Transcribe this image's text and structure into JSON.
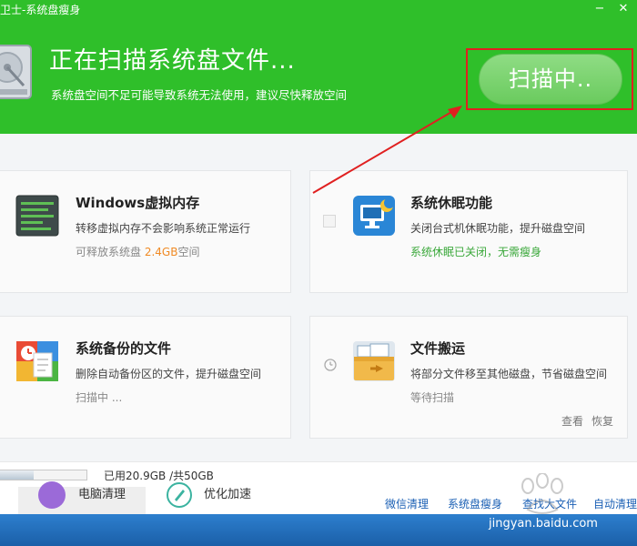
{
  "window": {
    "title": "卫士-系统盘瘦身",
    "minimize_glyph": "−",
    "close_glyph": "✕"
  },
  "header": {
    "heading": "正在扫描系统盘文件...",
    "subtitle": "系统盘空间不足可能导致系统无法使用，建议尽快释放空间",
    "scan_button": "扫描中.."
  },
  "cards": [
    {
      "title": "Windows虚拟内存",
      "desc": "转移虚拟内存不会影响系统正常运行",
      "status_prefix": "可释放系统盘 ",
      "status_value": "2.4GB",
      "status_suffix": "空间"
    },
    {
      "title": "系统休眠功能",
      "desc": "关闭台式机休眠功能，提升磁盘空间",
      "status": "系统休眠已关闭，无需瘦身"
    },
    {
      "title": "系统备份的文件",
      "desc": "删除自动备份区的文件，提升磁盘空间",
      "status": "扫描中 ..."
    },
    {
      "title": "文件搬运",
      "desc": "将部分文件移至其他磁盘，节省磁盘空间",
      "status": "等待扫描",
      "link_view": "查看",
      "link_restore": "恢复"
    }
  ],
  "usage": {
    "text": "已用20.9GB /共50GB",
    "used_fraction": 0.418
  },
  "bottom": {
    "tabs": [
      {
        "label": "电脑清理"
      },
      {
        "label": "优化加速"
      }
    ],
    "tools": [
      "微信清理",
      "系统盘瘦身",
      "查找大文件",
      "自动清理"
    ]
  },
  "watermark": {
    "text": "jingyan.baidu.com"
  },
  "colors": {
    "header_green": "#2fbf2a",
    "accent_orange": "#f08a24",
    "status_green": "#3aa83a",
    "annotation_red": "#e02020",
    "link_blue": "#1a5fb4"
  },
  "icons": {
    "disk": "hard-disk-icon",
    "virtual_memory": "memory-chip-icon",
    "hibernate": "monitor-moon-icon",
    "backup": "backup-file-icon",
    "move": "folder-move-icon"
  }
}
